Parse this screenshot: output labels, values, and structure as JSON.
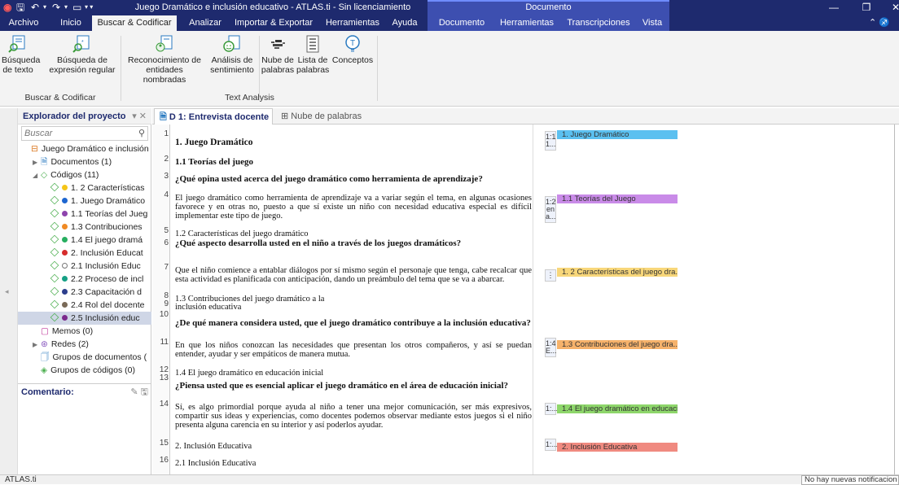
{
  "window": {
    "title": "Juego Dramático e inclusión educativo - ATLAS.ti - Sin licenciamiento",
    "context_label": "Documento"
  },
  "ribbon_tabs": [
    "Archivo",
    "Inicio",
    "Buscar & Codificar",
    "Analizar",
    "Importar & Exportar",
    "Herramientas",
    "Ayuda",
    "Documento",
    "Herramientas",
    "Transcripciones",
    "Vista"
  ],
  "ribbon": {
    "buttons": [
      {
        "label1": "Búsqueda",
        "label2": "de texto",
        "icon": "text-search-icon"
      },
      {
        "label1": "Búsqueda de",
        "label2": "expresión regular",
        "icon": "regex-search-icon"
      },
      {
        "label1": "Reconocimiento de",
        "label2": "entidades nombradas",
        "icon": "named-entity-icon"
      },
      {
        "label1": "Análisis de",
        "label2": "sentimiento",
        "icon": "sentiment-icon"
      },
      {
        "label1": "Nube de",
        "label2": "palabras",
        "icon": "word-cloud-icon"
      },
      {
        "label1": "Lista de",
        "label2": "palabras",
        "icon": "word-list-icon"
      },
      {
        "label1": "Conceptos",
        "label2": "",
        "icon": "concepts-icon"
      }
    ],
    "groups": [
      "Buscar & Codificar",
      "Text Analysis"
    ]
  },
  "explorer": {
    "title": "Explorador del proyecto",
    "search_placeholder": "Buscar",
    "items": [
      {
        "label": "Juego Dramático e inclusión",
        "level": 0,
        "kind": "project"
      },
      {
        "label": "Documentos (1)",
        "level": 1,
        "kind": "documents"
      },
      {
        "label": "Códigos (11)",
        "level": 1,
        "kind": "codes"
      },
      {
        "label": "1. 2 Características",
        "level": 2,
        "kind": "code",
        "color": "#f5c518"
      },
      {
        "label": "1. Juego Dramático",
        "level": 2,
        "kind": "code",
        "color": "#1e66d0"
      },
      {
        "label": "1.1 Teorías del Jueg",
        "level": 2,
        "kind": "code",
        "color": "#8e44ad"
      },
      {
        "label": "1.3 Contribuciones",
        "level": 2,
        "kind": "code",
        "color": "#f08a24"
      },
      {
        "label": "1.4 El juego dramá",
        "level": 2,
        "kind": "code",
        "color": "#27ae60"
      },
      {
        "label": "2. Inclusión Educat",
        "level": 2,
        "kind": "code",
        "color": "#d62c2c"
      },
      {
        "label": "2.1 Inclusión Educ",
        "level": 2,
        "kind": "code",
        "color": "#ffffff"
      },
      {
        "label": "2.2 Proceso de incl",
        "level": 2,
        "kind": "code",
        "color": "#16a085"
      },
      {
        "label": "2.3 Capacitación d",
        "level": 2,
        "kind": "code",
        "color": "#2c3e8c"
      },
      {
        "label": "2.4 Rol del docente",
        "level": 2,
        "kind": "code",
        "color": "#7a6a58"
      },
      {
        "label": "2.5 Inclusión educ",
        "level": 2,
        "kind": "code",
        "color": "#7a2a8c",
        "selected": true
      },
      {
        "label": "Memos (0)",
        "level": 1,
        "kind": "memos"
      },
      {
        "label": "Redes (2)",
        "level": 1,
        "kind": "networks"
      },
      {
        "label": "Grupos de documentos (",
        "level": 1,
        "kind": "docgroups"
      },
      {
        "label": "Grupos de códigos (0)",
        "level": 1,
        "kind": "codegroups"
      }
    ]
  },
  "comment": {
    "title": "Comentario:"
  },
  "doc_tabs": [
    {
      "label": "D 1: Entrevista docente",
      "active": true
    },
    {
      "label": "Nube de palabras",
      "active": false
    }
  ],
  "document": {
    "paragraphs": [
      {
        "n": "1",
        "text": "1. Juego Dramático",
        "style": "h"
      },
      {
        "n": "2",
        "text": "1.1 Teorías del juego",
        "style": "b"
      },
      {
        "n": "3",
        "text": "¿Qué opina usted acerca del juego dramático como herramienta de aprendizaje?",
        "style": "b"
      },
      {
        "n": "4",
        "text": "El juego dramático como herramienta de aprendizaje va a variar según el tema, en algunas ocasiones favorece y en otras no, puesto a que sí existe un niño con necesidad educativa especial es difícil implementar este tipo de juego.",
        "style": "n"
      },
      {
        "n": "5",
        "text": "1.2 Características del juego dramático",
        "style": "n"
      },
      {
        "n": "6",
        "text": "¿Qué aspecto desarrolla usted en el niño a través de los juegos dramáticos?",
        "style": "b"
      },
      {
        "n": "7",
        "text": "Que el niño comience a entablar diálogos por sí mismo según el personaje que tenga, cabe recalcar que esta actividad es planificada con anticipación, dando un preámbulo del tema que se va a abarcar.",
        "style": "n"
      },
      {
        "n": "8",
        "text": "1.3 Contribuciones del juego dramático a la",
        "style": "n"
      },
      {
        "n": "9",
        "text": "inclusión educativa",
        "style": "n"
      },
      {
        "n": "10",
        "text": "¿De qué manera considera usted, que el juego dramático contribuye a la inclusión educativa?",
        "style": "b"
      },
      {
        "n": "11",
        "text": "En que los niños conozcan las necesidades que presentan los otros compañeros, y así se puedan entender, ayudar y ser empáticos de manera mutua.",
        "style": "n"
      },
      {
        "n": "12",
        "text": "1.4 El juego dramático en educación inicial",
        "style": "n"
      },
      {
        "n": "13",
        "text": "¿Piensa usted que es esencial aplicar el juego dramático en el área de educación inicial?",
        "style": "b"
      },
      {
        "n": "14",
        "text": "Sí, es algo primordial porque ayuda al niño a tener una mejor comunicación, ser más expresivos, compartir sus ideas y experiencias, como docentes podemos observar mediante estos juegos si el niño presenta alguna carencia en su interior y así poderlos ayudar.",
        "style": "n"
      },
      {
        "n": "15",
        "text": "2. Inclusión Educativa",
        "style": "n"
      },
      {
        "n": "16",
        "text": "2.1 Inclusión Educativa",
        "style": "n"
      }
    ],
    "quote_badges": [
      "1:1 1...",
      "1:2 en a...",
      "⋮",
      "1:4 E...",
      "1:...",
      "1:..."
    ],
    "codes": [
      {
        "label": "1. Juego Dramático",
        "color": "#5bc0f0"
      },
      {
        "label": "1.1 Teorías del Juego",
        "color": "#c98be8"
      },
      {
        "label": "1. 2 Características del juego dra...",
        "color": "#f8d77a"
      },
      {
        "label": "1.3 Contribuciones del juego dra...",
        "color": "#f6b26b"
      },
      {
        "label": "1.4 El juego dramático en educaci...",
        "color": "#8ed66b"
      },
      {
        "label": "2. Inclusión Educativa",
        "color": "#f08a80"
      }
    ]
  },
  "status": {
    "app": "ATLAS.ti",
    "notification": "No hay nuevas notificacion"
  },
  "colors": {
    "titlebar": "#1e2a6e",
    "context": "#3d4fb0",
    "ribbon": "#f3f3f3",
    "accent": "#1e2a6e"
  }
}
